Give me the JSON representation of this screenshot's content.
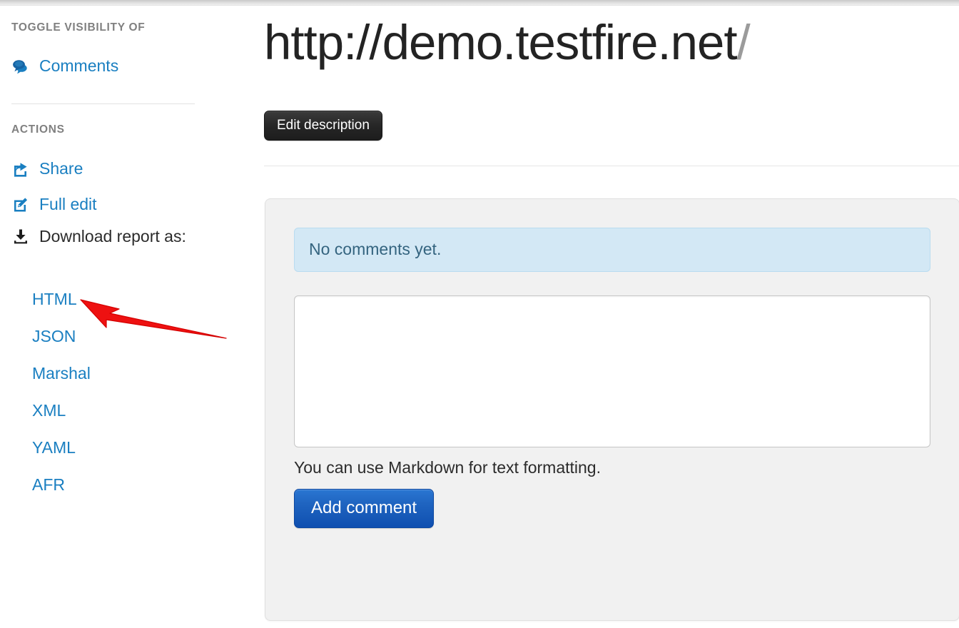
{
  "sidebar": {
    "toggle_heading": "TOGGLE VISIBILITY OF",
    "toggle_items": [
      {
        "label": "Comments",
        "icon": "comments-icon"
      }
    ],
    "actions_heading": "ACTIONS",
    "actions": [
      {
        "label": "Share",
        "icon": "share-icon"
      },
      {
        "label": "Full edit",
        "icon": "edit-pencil-icon"
      }
    ],
    "download": {
      "icon": "download-icon",
      "label": "Download report as:",
      "formats": [
        "HTML",
        "JSON",
        "Marshal",
        "XML",
        "YAML",
        "AFR"
      ]
    }
  },
  "main": {
    "title": "http://demo.testfire.net",
    "title_slash": "/",
    "edit_description_label": "Edit description",
    "comments": {
      "empty_notice": "No comments yet.",
      "textarea_value": "",
      "textarea_placeholder": "",
      "markdown_hint": "You can use Markdown for text formatting.",
      "add_comment_label": "Add comment"
    }
  },
  "annotation": {
    "arrow": "red-arrow-pointing-at-html-link",
    "color": "#ee1111"
  },
  "colors": {
    "link": "#1a7fc1",
    "heading_gray": "#808080",
    "panel_bg": "#f1f1f1",
    "alert_bg": "#d3e8f5",
    "alert_border": "#b9dcf0",
    "alert_text": "#34647f",
    "primary_button": "#1f64c0",
    "dark_button": "#262626",
    "title_text": "#232323",
    "title_slash": "#9b9b9b"
  }
}
